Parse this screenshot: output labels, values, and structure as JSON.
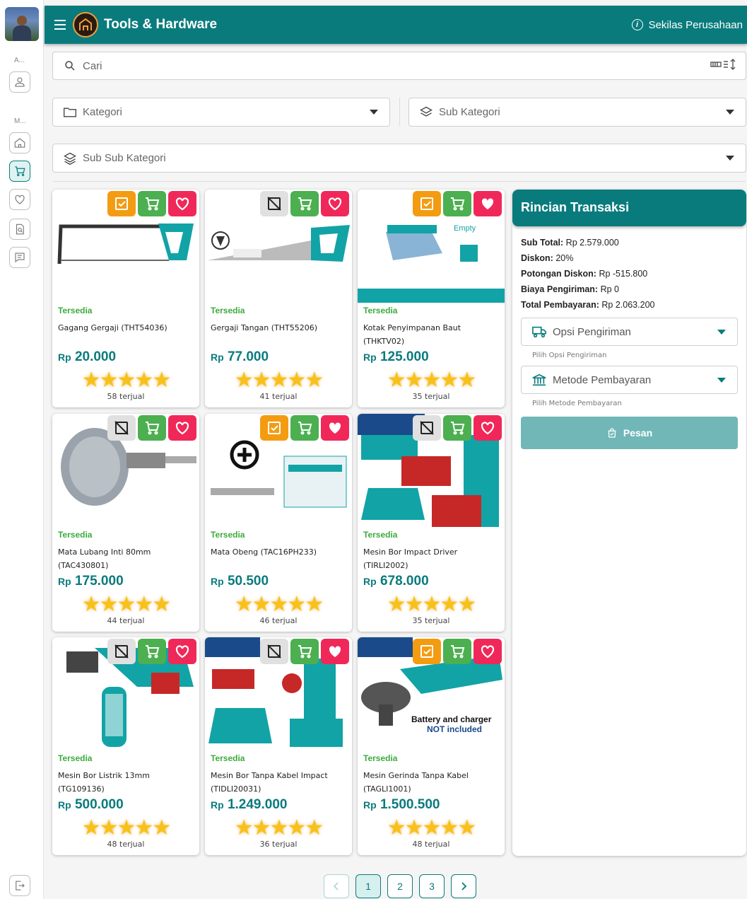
{
  "rail": {
    "section_a": "A...",
    "section_m": "M...",
    "items": [
      "user-icon",
      "home-icon",
      "cart-icon",
      "heart-icon",
      "search-doc-icon",
      "chat-icon"
    ],
    "logout": "logout-icon"
  },
  "header": {
    "brand": "Tools & Hardware",
    "about": "Sekilas Perusahaan"
  },
  "search": {
    "placeholder": "Cari"
  },
  "filters": {
    "category": "Kategori",
    "sub_category": "Sub Kategori",
    "sub_sub_category": "Sub Sub Kategori"
  },
  "products": [
    {
      "status": "Tersedia",
      "name": "Gagang Gergaji (THT54036)",
      "currency": "Rp",
      "price": "20.000",
      "stars": "★★★★★",
      "sold": "58 terjual"
    },
    {
      "status": "Tersedia",
      "name": "Gergaji Tangan (THT55206)",
      "currency": "Rp",
      "price": "77.000",
      "stars": "★★★★★",
      "sold": "41 terjual"
    },
    {
      "status": "Tersedia",
      "name": "Kotak Penyimpanan Baut (THKTV02)",
      "currency": "Rp",
      "price": "125.000",
      "stars": "★★★★★",
      "sold": "35 terjual"
    },
    {
      "status": "Tersedia",
      "name": "Mata Lubang Inti 80mm (TAC430801)",
      "currency": "Rp",
      "price": "175.000",
      "stars": "★★★★★",
      "sold": "44 terjual"
    },
    {
      "status": "Tersedia",
      "name": "Mata Obeng (TAC16PH233)",
      "currency": "Rp",
      "price": "50.500",
      "stars": "★★★★★",
      "sold": "46 terjual"
    },
    {
      "status": "Tersedia",
      "name": "Mesin Bor Impact Driver (TIRLI2002)",
      "currency": "Rp",
      "price": "678.000",
      "stars": "★★★★★",
      "sold": "35 terjual"
    },
    {
      "status": "Tersedia",
      "name": "Mesin Bor Listrik 13mm (TG109136)",
      "currency": "Rp",
      "price": "500.000",
      "stars": "★★★★★",
      "sold": "48 terjual"
    },
    {
      "status": "Tersedia",
      "name": "Mesin Bor Tanpa Kabel Impact (TIDLI20031)",
      "currency": "Rp",
      "price": "1.249.000",
      "stars": "★★★★★",
      "sold": "36 terjual"
    },
    {
      "status": "Tersedia",
      "name": "Mesin Gerinda Tanpa Kabel (TAGLI1001)",
      "currency": "Rp",
      "price": "1.500.500",
      "stars": "★★★★★",
      "sold": "48 terjual"
    }
  ],
  "image_text": {
    "empty": "Empty",
    "battery_line1": "Battery and charger",
    "battery_line2": "NOT included"
  },
  "transaction": {
    "title": "Rincian Transaksi",
    "subtotal_label": "Sub Total:",
    "subtotal": "Rp 2.579.000",
    "discount_label": "Diskon:",
    "discount": "20%",
    "discount_cut_label": "Potongan Diskon:",
    "discount_cut": "Rp -515.800",
    "shipping_cost_label": "Biaya Pengiriman:",
    "shipping_cost": "Rp 0",
    "total_label": "Total Pembayaran:",
    "total": "Rp 2.063.200",
    "shipping_option": "Opsi Pengiriman",
    "shipping_hint": "Pilih Opsi Pengiriman",
    "payment_method": "Metode Pembayaran",
    "payment_hint": "Pilih Metode Pembayaran",
    "order_button": "Pesan"
  },
  "pagination": {
    "pages": [
      "1",
      "2",
      "3"
    ],
    "current": "1"
  },
  "colors": {
    "primary": "#0a7b7d",
    "available": "#3cab3c",
    "orange": "#f39c12",
    "green": "#4caf50",
    "pink": "#f0285a"
  }
}
